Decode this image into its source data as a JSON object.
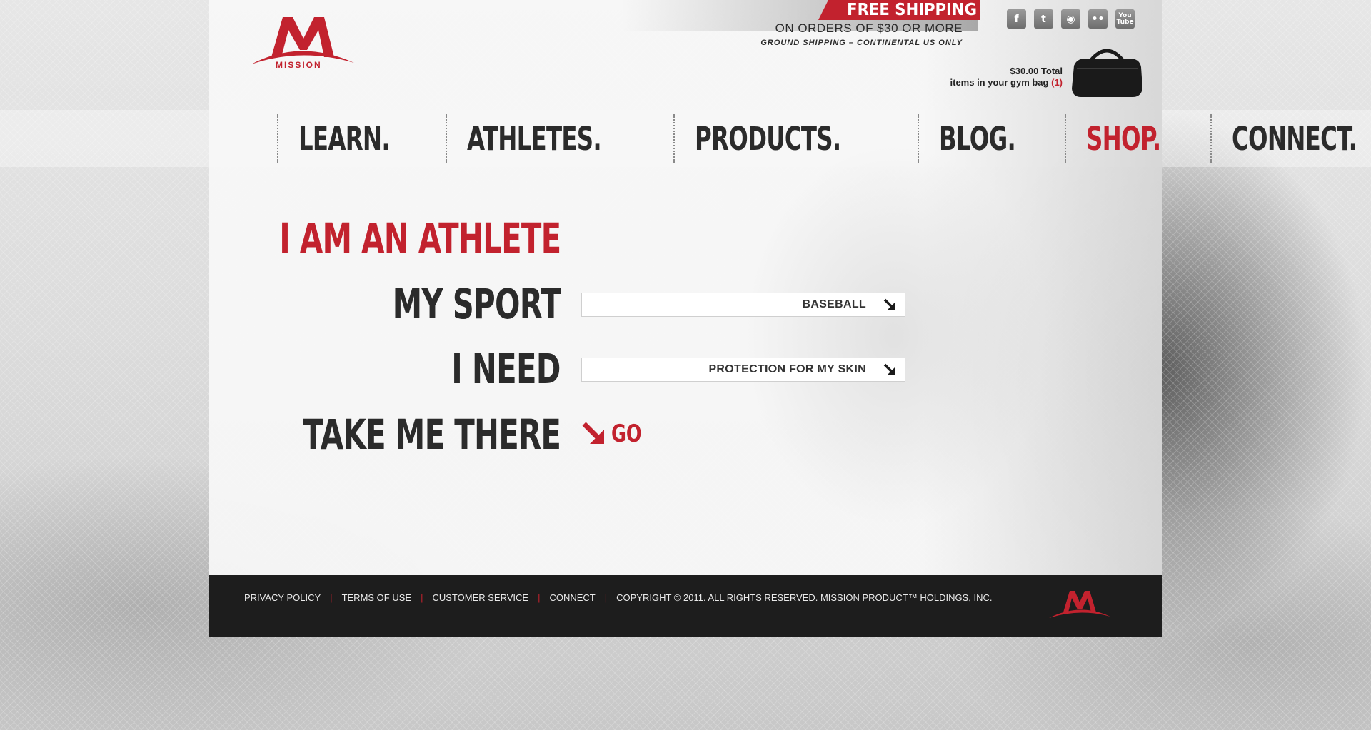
{
  "logo": {
    "brand": "MISSION"
  },
  "shipping": {
    "title": "FREE SHIPPING",
    "line2": "ON ORDERS OF $30 OR MORE",
    "line3": "GROUND SHIPPING – CONTINENTAL US ONLY"
  },
  "social": [
    {
      "name": "facebook-icon",
      "glyph": "f"
    },
    {
      "name": "twitter-icon",
      "glyph": "t"
    },
    {
      "name": "rss-icon",
      "glyph": "◉"
    },
    {
      "name": "flickr-icon",
      "glyph": "••"
    },
    {
      "name": "youtube-icon",
      "glyph": "You Tube"
    }
  ],
  "cart": {
    "total": "$30.00 Total",
    "items_text": "items in your gym bag",
    "count": "(1)"
  },
  "nav": [
    {
      "label": "LEARN.",
      "active": false
    },
    {
      "label": "ATHLETES.",
      "active": false
    },
    {
      "label": "PRODUCTS.",
      "active": false
    },
    {
      "label": "BLOG.",
      "active": false
    },
    {
      "label": "SHOP.",
      "active": true
    },
    {
      "label": "CONNECT.",
      "active": false
    }
  ],
  "form": {
    "headline": "I AM AN ATHLETE",
    "sport_label": "MY SPORT",
    "sport_value": "BASEBALL",
    "need_label": "I NEED",
    "need_value": "PROTECTION FOR MY SKIN",
    "submit_label": "TAKE ME THERE",
    "go_label": "GO"
  },
  "footer": {
    "links": [
      "PRIVACY POLICY",
      "TERMS OF USE",
      "CUSTOMER SERVICE",
      "CONNECT"
    ],
    "copyright": "COPYRIGHT © 2011. ALL RIGHTS RESERVED. MISSION PRODUCT™ HOLDINGS, INC."
  },
  "colors": {
    "accent": "#c2222e",
    "text": "#2b2b2b",
    "footer_bg": "#1d1d1d"
  }
}
